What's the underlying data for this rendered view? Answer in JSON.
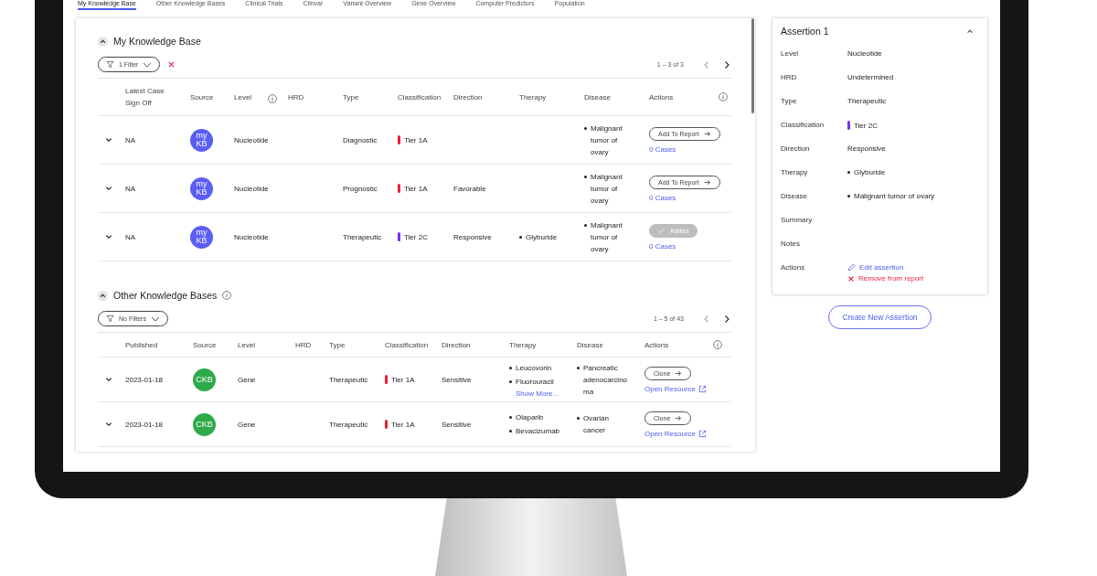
{
  "tabs": [
    {
      "label": "My Knowledge Base",
      "selected": true
    },
    {
      "label": "Other Knowledge Bases",
      "selected": false
    },
    {
      "label": "Clinical Trials",
      "selected": false
    },
    {
      "label": "Clinvar",
      "selected": false
    },
    {
      "label": "Variant Overview",
      "selected": false
    },
    {
      "label": "Gene Overview",
      "selected": false
    },
    {
      "label": "Computer Predictors",
      "selected": false
    },
    {
      "label": "Population",
      "selected": false
    }
  ],
  "my_kb": {
    "title": "My Knowledge Base",
    "expanded": true,
    "filter": "1 Filter",
    "has_clear": true,
    "pagination": {
      "range": "1 – 3 of 3",
      "prev_disabled": true,
      "next_disabled": false
    },
    "columns": [
      "Latest Case Sign Off",
      "Source",
      "Level",
      "HRD",
      "Type",
      "Classification",
      "Direction",
      "Therapy",
      "Disease",
      "Actions"
    ],
    "rows": [
      {
        "date": "NA",
        "source": {
          "label": "my KB",
          "color": "#5b5ef4"
        },
        "level": "Nucleotide",
        "type": "Diagnostic",
        "classification": {
          "label": "Tier 1A",
          "color": "#e8213a"
        },
        "disease": [
          "Malignant tumor of ovary"
        ],
        "action": {
          "kind": "add",
          "label": "Add To Report"
        },
        "cases": "0 Cases"
      },
      {
        "date": "NA",
        "source": {
          "label": "my KB",
          "color": "#5b5ef4"
        },
        "level": "Nucleotide",
        "type": "Prognostic",
        "classification": {
          "label": "Tier 1A",
          "color": "#e8213a"
        },
        "direction": "Favorable",
        "disease": [
          "Malignant tumor of ovary"
        ],
        "action": {
          "kind": "add",
          "label": "Add To Report"
        },
        "cases": "0 Cases"
      },
      {
        "date": "NA",
        "source": {
          "label": "my KB",
          "color": "#5b5ef4"
        },
        "level": "Nucleotide",
        "type": "Therapeutic",
        "classification": {
          "label": "Tier 2C",
          "color": "#7a2ff0"
        },
        "direction": "Responsive",
        "therapy": [
          "Glyburide"
        ],
        "disease": [
          "Malignant tumor of ovary"
        ],
        "action": {
          "kind": "added",
          "label": "Added"
        },
        "cases": "0 Cases"
      }
    ]
  },
  "other_kb": {
    "title": "Other Knowledge Bases",
    "expanded": true,
    "filter": "No Filters",
    "pagination": {
      "range": "1 – 5 of 43",
      "prev_disabled": true,
      "next_disabled": false
    },
    "columns": [
      "Published",
      "Source",
      "Level",
      "HRD",
      "Type",
      "Classification",
      "Direction",
      "Therapy",
      "Disease",
      "Actions"
    ],
    "rows": [
      {
        "date": "2023-01-18",
        "source": {
          "label": "CKB",
          "color": "#2faa4a"
        },
        "level": "Gene",
        "type": "Therapeutic",
        "classification": {
          "label": "Tier 1A",
          "color": "#e8213a"
        },
        "direction": "Sensitive",
        "therapy": [
          "Leucovorin",
          "Fluorouracil"
        ],
        "show_more": "Show More...",
        "disease": [
          "Pancreatic adenocarcinoma"
        ],
        "action": {
          "kind": "clone",
          "label": "Clone"
        },
        "link": "Open Resource"
      },
      {
        "date": "2023-01-18",
        "source": {
          "label": "CKB",
          "color": "#2faa4a"
        },
        "level": "Gene",
        "type": "Therapeutic",
        "classification": {
          "label": "Tier 1A",
          "color": "#e8213a"
        },
        "direction": "Sensitive",
        "therapy": [
          "Olaparib",
          "Bevacizumab"
        ],
        "disease": [
          "Ovarian cancer"
        ],
        "action": {
          "kind": "clone",
          "label": "Clone"
        },
        "link": "Open Resource"
      }
    ]
  },
  "assertion": {
    "title": "Assertion 1",
    "expanded": true,
    "fields": [
      {
        "kind": "text",
        "label": "Level",
        "value": "Nucleotide"
      },
      {
        "kind": "text",
        "label": "HRD",
        "value": "Undetermined"
      },
      {
        "kind": "text",
        "label": "Type",
        "value": "Therapeutic"
      },
      {
        "kind": "tier",
        "label": "Classification",
        "value": "Tier 2C",
        "color": "#7a2ff0"
      },
      {
        "kind": "text",
        "label": "Direction",
        "value": "Responsive"
      },
      {
        "kind": "list",
        "label": "Therapy",
        "items": [
          "Glyburide"
        ]
      },
      {
        "kind": "list",
        "label": "Disease",
        "items": [
          "Malignant tumor of ovary"
        ]
      },
      {
        "kind": "text",
        "label": "Summary"
      },
      {
        "kind": "text",
        "label": "Notes"
      },
      {
        "kind": "actions",
        "label": "Actions",
        "edit": "Edit assertion",
        "remove": "Remove from report"
      }
    ]
  },
  "create_button": "Create New Assertion"
}
